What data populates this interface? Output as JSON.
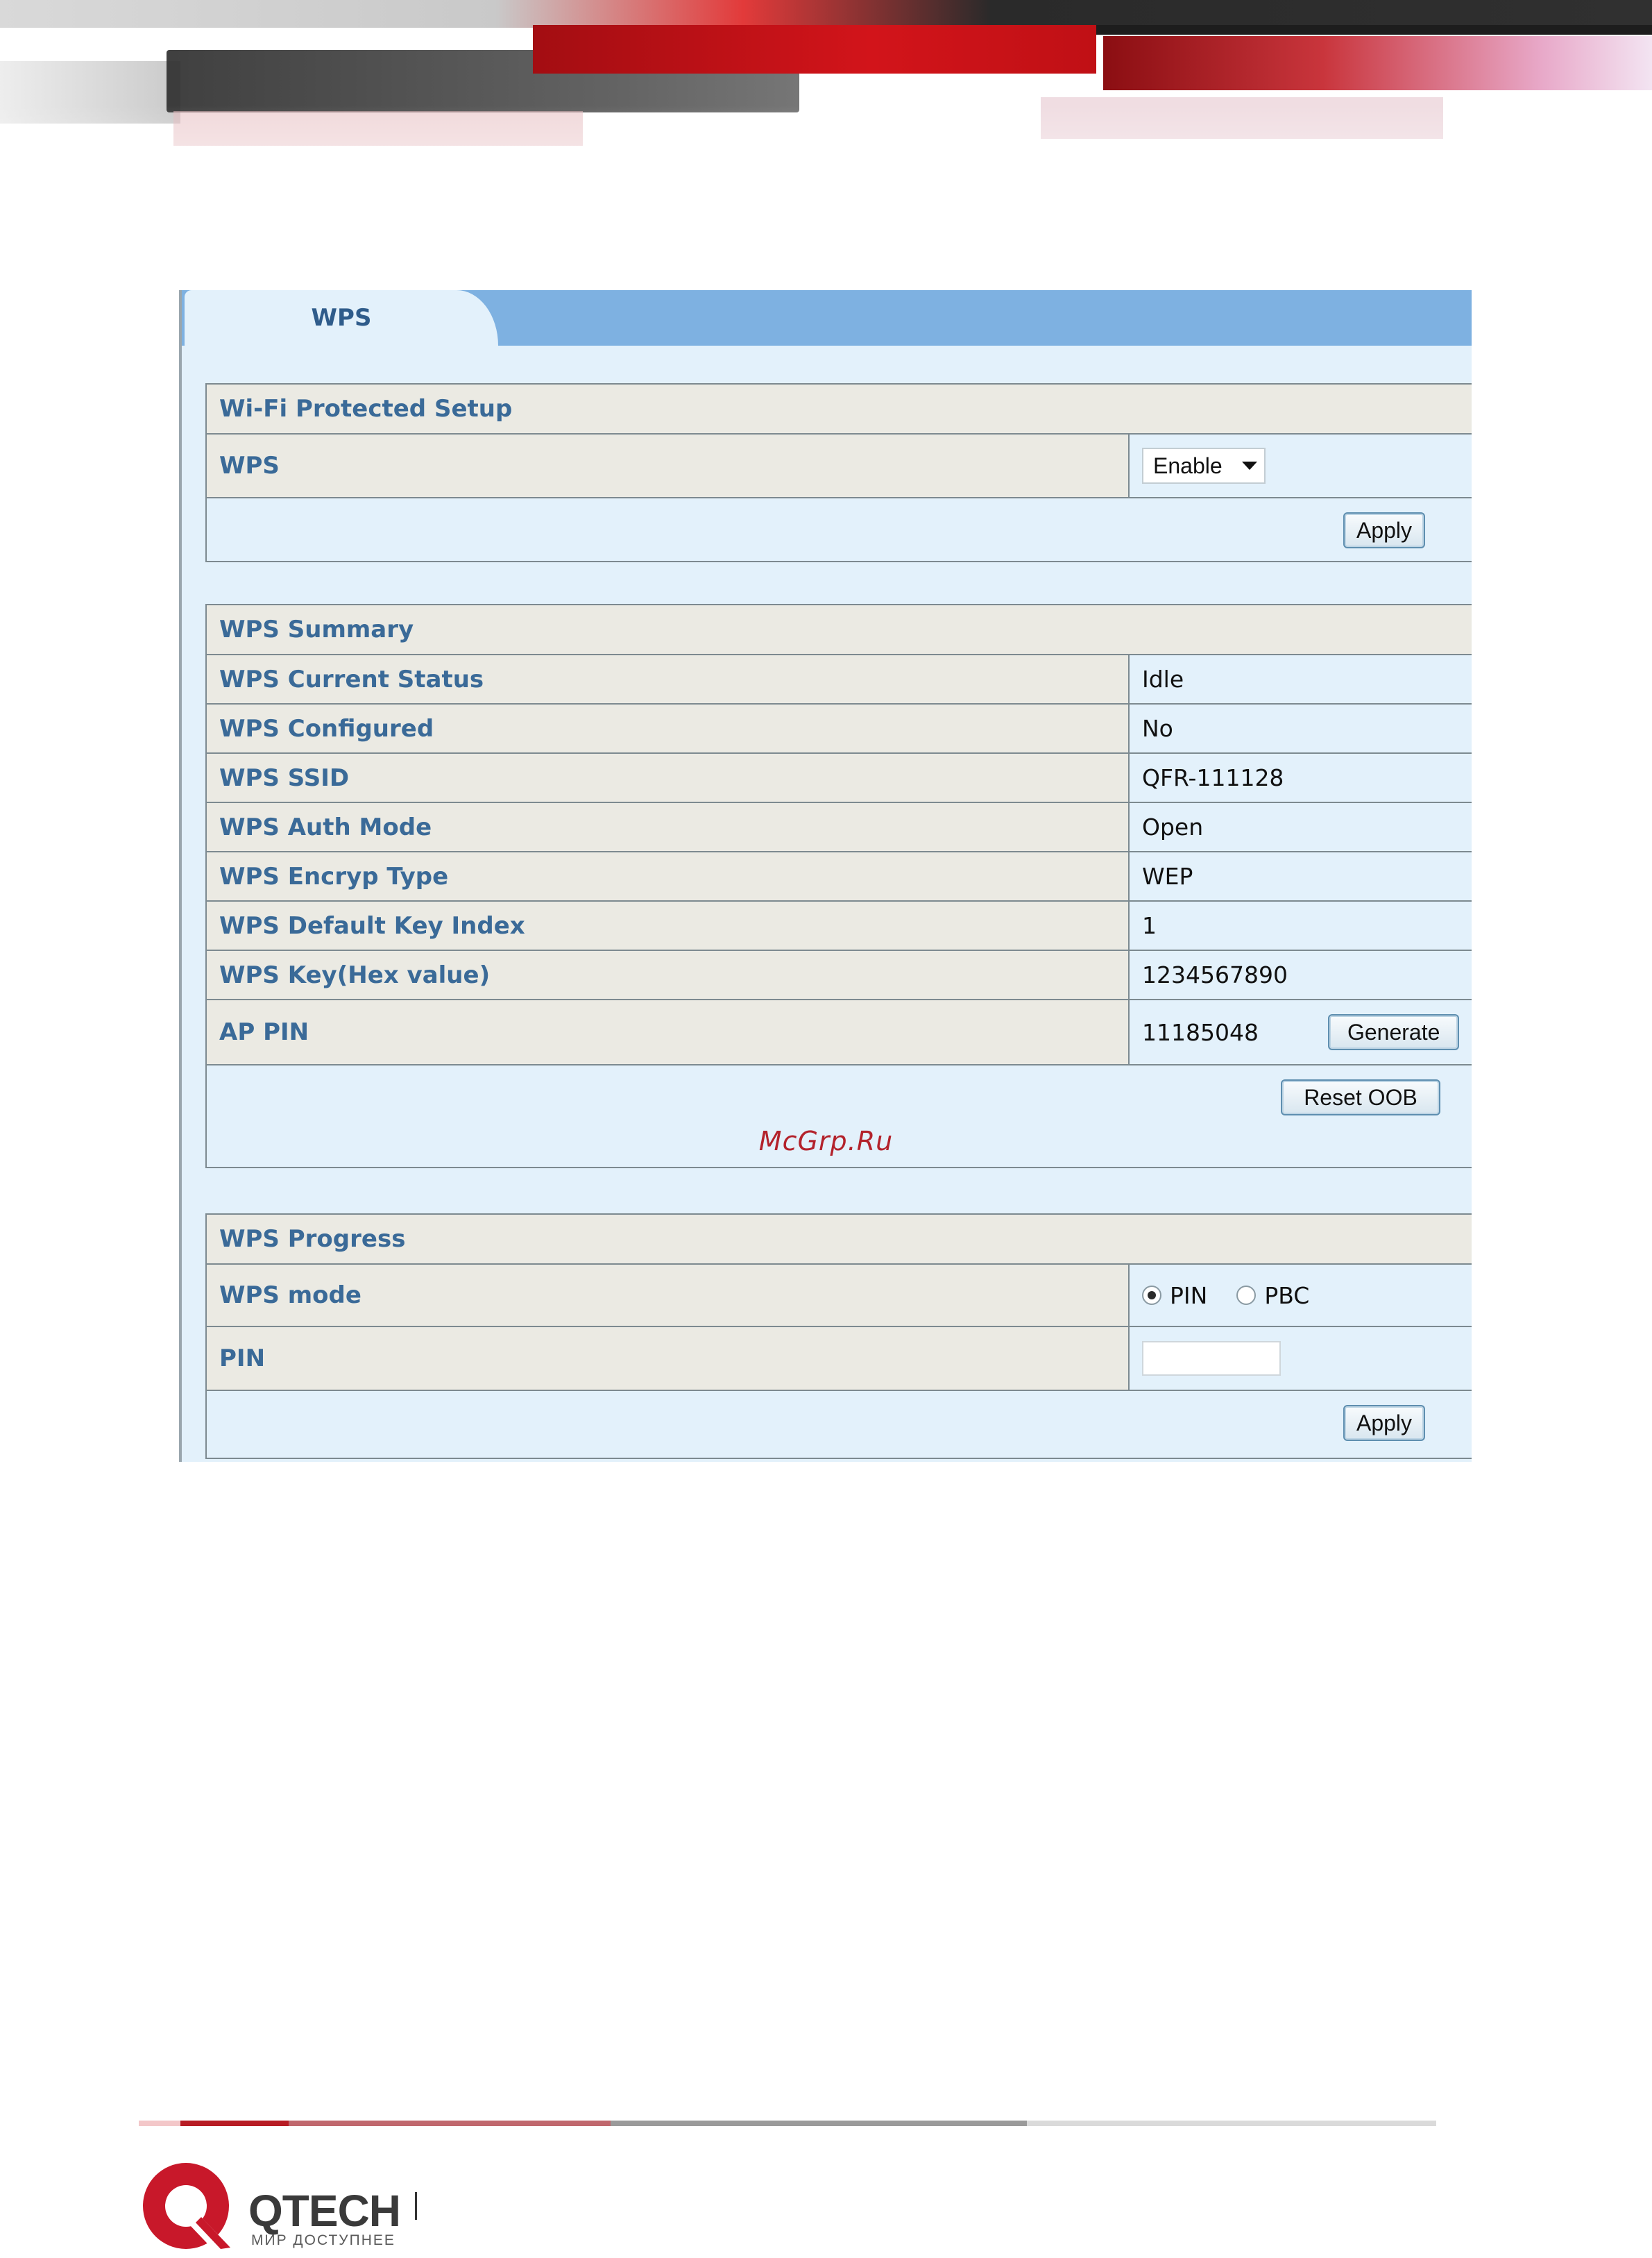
{
  "tab": {
    "label": "WPS"
  },
  "setup": {
    "header": "Wi-Fi Protected Setup",
    "wps_label": "WPS",
    "wps_select_value": "Enable",
    "apply_label": "Apply"
  },
  "summary": {
    "header": "WPS Summary",
    "rows": [
      {
        "label": "WPS Current Status",
        "value": "Idle"
      },
      {
        "label": "WPS Configured",
        "value": "No"
      },
      {
        "label": "WPS SSID",
        "value": "QFR-111128"
      },
      {
        "label": "WPS Auth Mode",
        "value": "Open"
      },
      {
        "label": "WPS Encryp Type",
        "value": "WEP"
      },
      {
        "label": "WPS Default Key Index",
        "value": "1"
      },
      {
        "label": "WPS Key(Hex value)",
        "value": "1234567890"
      }
    ],
    "ap_pin_label": "AP PIN",
    "ap_pin_value": "11185048",
    "generate_label": "Generate",
    "reset_label": "Reset OOB"
  },
  "progress": {
    "header": "WPS Progress",
    "mode_label": "WPS mode",
    "mode_options": [
      "PIN",
      "PBC"
    ],
    "mode_selected": "PIN",
    "pin_label": "PIN",
    "pin_value": "",
    "apply_label": "Apply"
  },
  "watermark": "McGrp.Ru",
  "footer": {
    "brand": "QTECH",
    "tagline": "МИР ДОСТУПНЕЕ"
  },
  "colors": {
    "label_text": "#3a6a98",
    "tab_bar": "#7eb1e1",
    "panel_bg": "#e3f1fb",
    "label_bg": "#ebeae3",
    "brand_red": "#c8182a"
  }
}
